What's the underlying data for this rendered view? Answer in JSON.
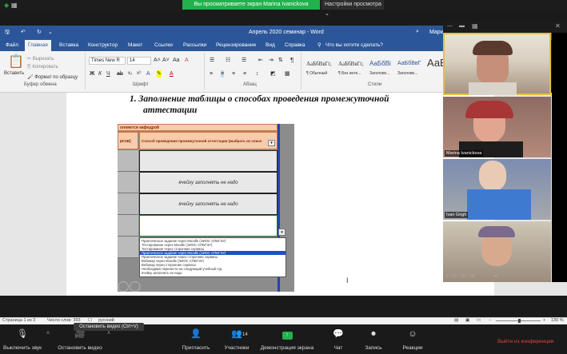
{
  "zoom_top": {
    "share_banner": "Вы просматриваете экран Marina Ivanickova",
    "view_options": "Настройки просмотра"
  },
  "word": {
    "title": "Апрель 2020 семинар - Word",
    "user": "Мари",
    "tabs": [
      "Файл",
      "Главная",
      "Вставка",
      "Конструктор",
      "Макет",
      "Ссылки",
      "Рассылки",
      "Рецензирование",
      "Вид",
      "Справка",
      "Что вы хотите сделать?"
    ],
    "clipboard": {
      "paste": "Вставить",
      "cut": "Вырезать",
      "copy": "Копировать",
      "format_painter": "Формат по образцу",
      "group": "Буфер обмена"
    },
    "font": {
      "name": "Times New R",
      "size": "14",
      "bold": "Ж",
      "italic": "К",
      "underline": "Ч",
      "group": "Шрифт"
    },
    "paragraph_group": "Абзац",
    "styles": [
      {
        "preview": "АаБбВвГг,",
        "name": "¶ Обычный"
      },
      {
        "preview": "АаБбВвГг,",
        "name": "¶ Без инте..."
      },
      {
        "preview": "АаБбВі",
        "name": "Заголово..."
      },
      {
        "preview": "АаБбВвГ",
        "name": "Заголово..."
      },
      {
        "preview": "АаБ",
        "name": "Название"
      }
    ],
    "styles_group": "Стили",
    "heading": "1.  Заполнение  таблицы  о  способах  проведения  промежуточной",
    "heading2": "аттестации"
  },
  "excel": {
    "header_top": "олняется кафедрой",
    "header_col1": "рсов)",
    "header_col2": "Способ проведения  промежуточной аттестации (выбрать из списк",
    "row_note1": "ячейку заполнять не надо",
    "row_note2": "ячейку заполнять не надо",
    "dropdown": [
      "Практическое задание  через Moodle (ЭИОС СПБГЭУ)",
      "Тестирование через Moodle (ЭИОС СПБГЭУ)",
      "Тестирование через сторонние сервисы",
      "Практическое задание через Moodle (ЭИОС СПБГЭУ)",
      "Практическое задание через сторонние сервисы",
      "Вебинар через Moodle (ЭИОС СПБГЭУ)",
      "Вебинар через сторонние сервисы",
      "Необходимо перенести на следующий учебный год",
      "ячейку заполнять не надо"
    ]
  },
  "status": {
    "page": "Страница 1 из 3",
    "words": "Число слов: 393",
    "language": "русский",
    "zoom": "130 %"
  },
  "participants": [
    {
      "name": ""
    },
    {
      "name": "Marina Ivanickova"
    },
    {
      "name": "Ivan Grigh"
    },
    {
      "name": "+ 7(4) 782 766"
    }
  ],
  "zoom_bottom": {
    "mute": "Выключить звук",
    "video": "Остановить видео",
    "tooltip": "Остановить видео (Ctrl+V)",
    "invite": "Пригласить",
    "participants": "Участники",
    "participants_count": "14",
    "share": "Демонстрация экрана",
    "chat": "Чат",
    "record": "Запись",
    "reactions": "Реакции",
    "leave": "Выйти из конференции"
  }
}
